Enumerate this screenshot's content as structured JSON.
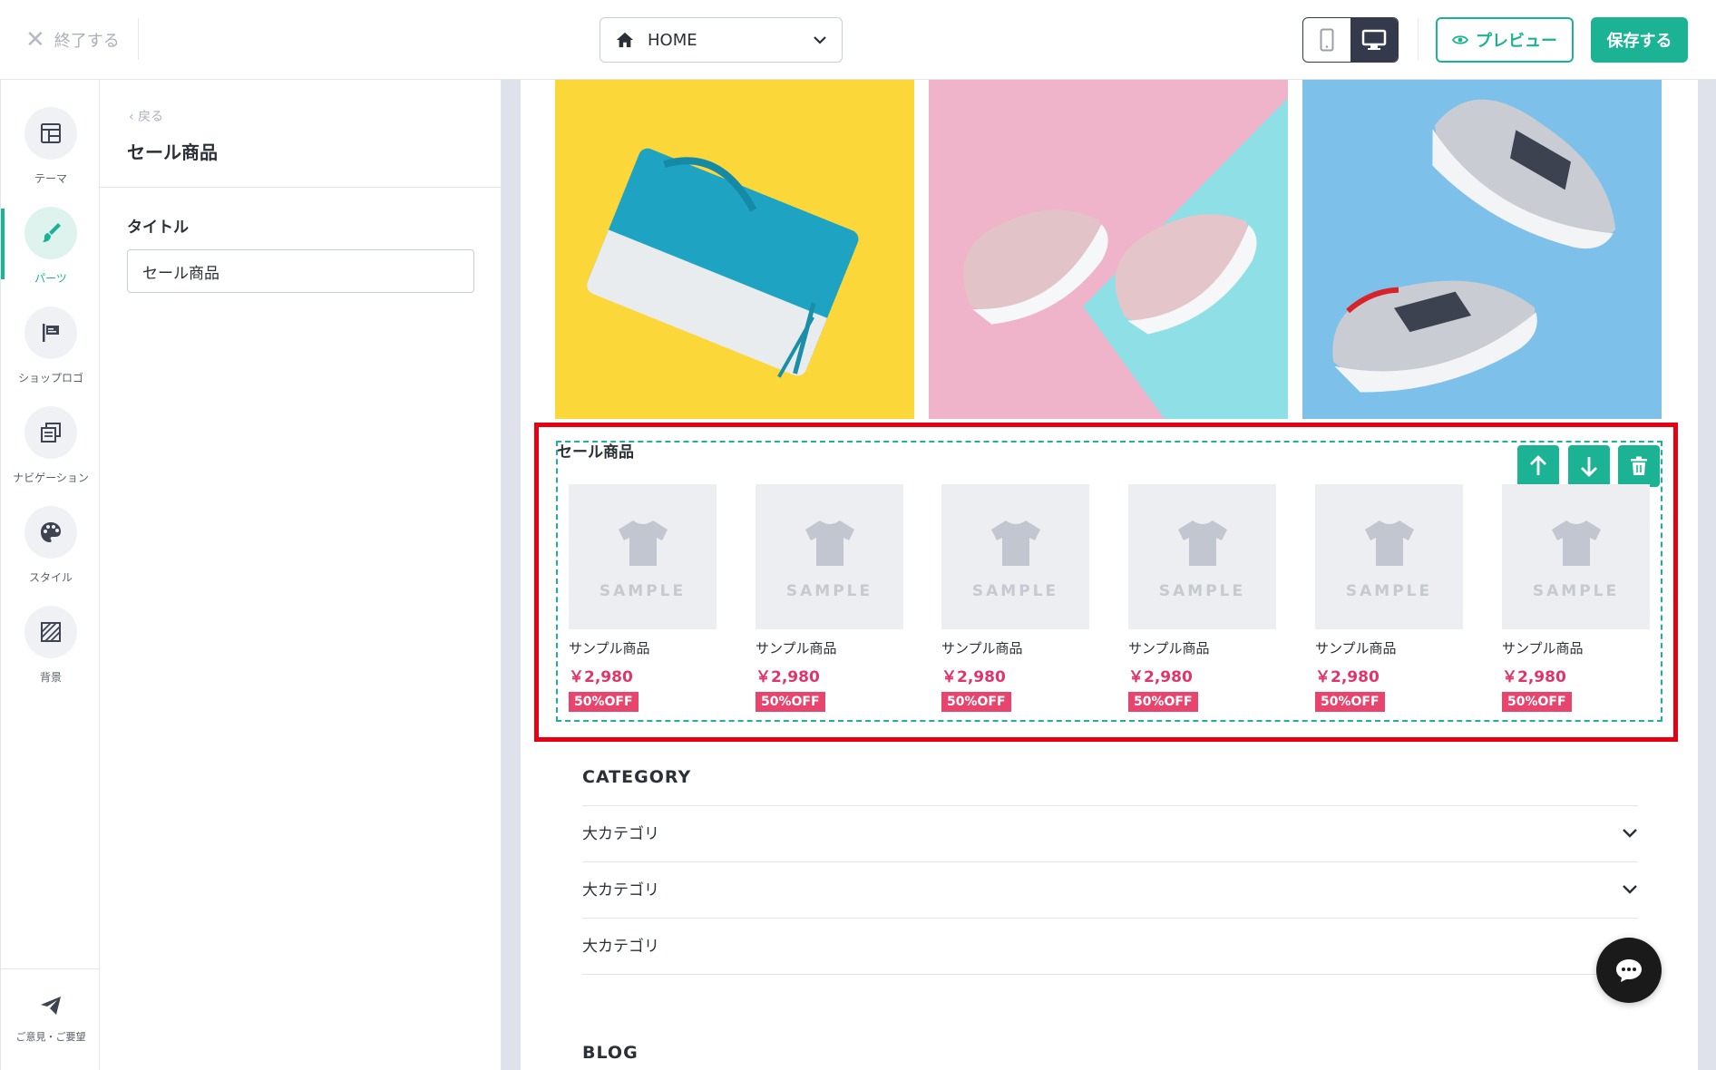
{
  "topbar": {
    "exit_label": "終了する",
    "page_select_value": "HOME",
    "preview_label": "プレビュー",
    "save_label": "保存する"
  },
  "rail": {
    "items": [
      {
        "label": "テーマ",
        "icon": "layout-icon"
      },
      {
        "label": "パーツ",
        "icon": "brush-icon"
      },
      {
        "label": "ショップロゴ",
        "icon": "flag-icon"
      },
      {
        "label": "ナビゲーション",
        "icon": "navigation-icon"
      },
      {
        "label": "スタイル",
        "icon": "palette-icon"
      },
      {
        "label": "背景",
        "icon": "background-pattern-icon"
      }
    ],
    "feedback_label": "ご意見・ご要望",
    "active_index": 1
  },
  "panel": {
    "back_label": "戻る",
    "title": "セール商品",
    "field_label": "タイトル",
    "field_value": "セール商品"
  },
  "sale": {
    "title": "セール商品",
    "products": [
      {
        "name": "サンプル商品",
        "price": "￥2,980",
        "badge": "50%OFF",
        "thumb_text": "SAMPLE"
      },
      {
        "name": "サンプル商品",
        "price": "￥2,980",
        "badge": "50%OFF",
        "thumb_text": "SAMPLE"
      },
      {
        "name": "サンプル商品",
        "price": "￥2,980",
        "badge": "50%OFF",
        "thumb_text": "SAMPLE"
      },
      {
        "name": "サンプル商品",
        "price": "￥2,980",
        "badge": "50%OFF",
        "thumb_text": "SAMPLE"
      },
      {
        "name": "サンプル商品",
        "price": "￥2,980",
        "badge": "50%OFF",
        "thumb_text": "SAMPLE"
      },
      {
        "name": "サンプル商品",
        "price": "￥2,980",
        "badge": "50%OFF",
        "thumb_text": "SAMPLE"
      }
    ]
  },
  "category": {
    "title": "CATEGORY",
    "rows": [
      "大カテゴリ",
      "大カテゴリ",
      "大カテゴリ"
    ]
  },
  "blog": {
    "title": "BLOG"
  },
  "colors": {
    "accent": "#1bb394",
    "price": "#e0356a",
    "badge": "#e8456e",
    "highlight": "#e60012"
  }
}
